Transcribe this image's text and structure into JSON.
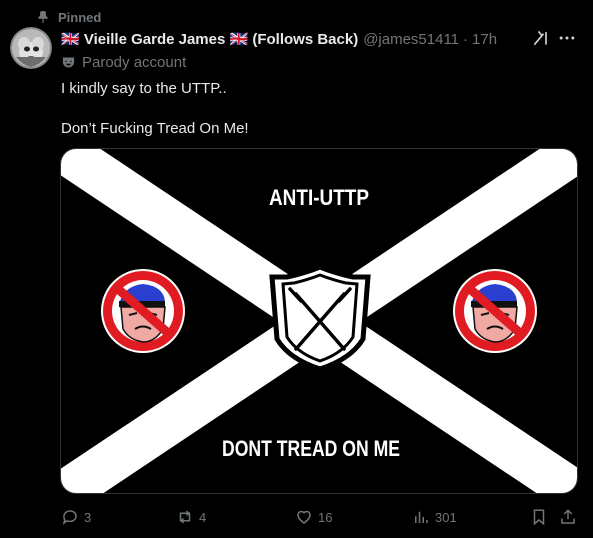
{
  "pinned": {
    "label": "Pinned"
  },
  "author": {
    "display_name": "🇬🇧 Vieille Garde James 🇬🇧 (Follows Back)",
    "handle": "@james51411",
    "separator": "·",
    "time": "17h",
    "account_label": "Parody account"
  },
  "tweet": {
    "line1": "I kindly say to the UTTP..",
    "line2": "Don’t Fucking Tread On Me!"
  },
  "media": {
    "top_text": "ANTI-UTTP",
    "bottom_text": "DONT TREAD ON ME"
  },
  "actions": {
    "replies": "3",
    "reposts": "4",
    "likes": "16",
    "views": "301"
  },
  "icons": {
    "pin": "pin-icon",
    "parody": "theater-masks-icon",
    "grok": "grok-icon",
    "more": "more-icon",
    "reply": "reply-icon",
    "repost": "repost-icon",
    "like": "heart-icon",
    "views": "views-icon",
    "bookmark": "bookmark-icon",
    "share": "share-icon"
  },
  "colors": {
    "text": "#e7e9ea",
    "muted": "#71767b",
    "background": "#000000",
    "prohibition_red": "#e11b22",
    "police_blue": "#2a3ecf"
  }
}
